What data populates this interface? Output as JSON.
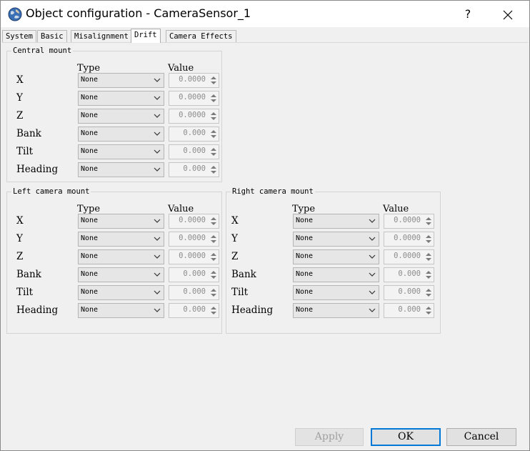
{
  "window": {
    "title": "Object configuration - CameraSensor_1",
    "help_label": "?",
    "close_label": "✕"
  },
  "tabs": [
    {
      "label": "System",
      "active": false
    },
    {
      "label": "Basic",
      "active": false
    },
    {
      "label": "Misalignment",
      "active": false
    },
    {
      "label": "Drift",
      "active": true
    },
    {
      "label": "Camera Effects",
      "active": false
    }
  ],
  "groups": {
    "central": {
      "title": "Central mount",
      "type_header": "Type",
      "value_header": "Value",
      "rows": [
        {
          "label": "X",
          "type": "None",
          "value": "0.0000"
        },
        {
          "label": "Y",
          "type": "None",
          "value": "0.0000"
        },
        {
          "label": "Z",
          "type": "None",
          "value": "0.0000"
        },
        {
          "label": "Bank",
          "type": "None",
          "value": "0.000"
        },
        {
          "label": "Tilt",
          "type": "None",
          "value": "0.000"
        },
        {
          "label": "Heading",
          "type": "None",
          "value": "0.000"
        }
      ]
    },
    "left": {
      "title": "Left camera mount",
      "type_header": "Type",
      "value_header": "Value",
      "rows": [
        {
          "label": "X",
          "type": "None",
          "value": "0.0000"
        },
        {
          "label": "Y",
          "type": "None",
          "value": "0.0000"
        },
        {
          "label": "Z",
          "type": "None",
          "value": "0.0000"
        },
        {
          "label": "Bank",
          "type": "None",
          "value": "0.000"
        },
        {
          "label": "Tilt",
          "type": "None",
          "value": "0.000"
        },
        {
          "label": "Heading",
          "type": "None",
          "value": "0.000"
        }
      ]
    },
    "right": {
      "title": "Right camera mount",
      "type_header": "Type",
      "value_header": "Value",
      "rows": [
        {
          "label": "X",
          "type": "None",
          "value": "0.0000"
        },
        {
          "label": "Y",
          "type": "None",
          "value": "0.0000"
        },
        {
          "label": "Z",
          "type": "None",
          "value": "0.0000"
        },
        {
          "label": "Bank",
          "type": "None",
          "value": "0.000"
        },
        {
          "label": "Tilt",
          "type": "None",
          "value": "0.000"
        },
        {
          "label": "Heading",
          "type": "None",
          "value": "0.000"
        }
      ]
    }
  },
  "buttons": {
    "apply": "Apply",
    "ok": "OK",
    "cancel": "Cancel"
  },
  "colors": {
    "default_button_border": "#0078d7",
    "disabled_text": "#a0a0a0"
  }
}
